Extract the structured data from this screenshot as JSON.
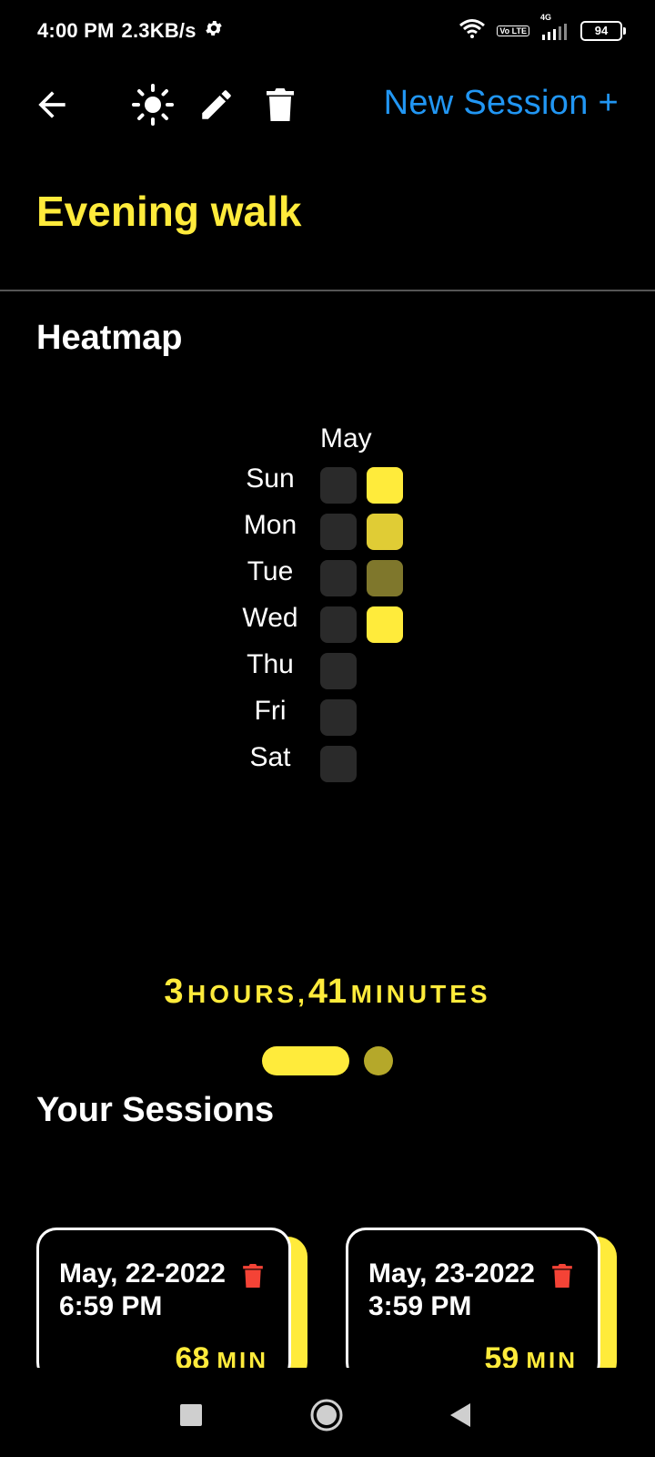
{
  "status_bar": {
    "time": "4:00 PM",
    "speed": "2.3KB/s",
    "volte": "Vo LTE",
    "network": "4G",
    "battery": "94"
  },
  "toolbar": {
    "new_session_label": "New Session +"
  },
  "activity": {
    "title": "Evening walk"
  },
  "heatmap": {
    "section_title": "Heatmap",
    "month": "May",
    "days": [
      "Sun",
      "Mon",
      "Tue",
      "Wed",
      "Thu",
      "Fri",
      "Sat"
    ],
    "cell_colors": {
      "empty": "#2a2a2a",
      "col2": [
        "#ffeb3b",
        "#e0cc35",
        "#7f772c",
        "#ffeb3b"
      ]
    }
  },
  "total": {
    "hours": "3",
    "hours_unit": "HOURS,",
    "minutes": "41",
    "minutes_unit": "MINUTES"
  },
  "sessions": {
    "section_title": "Your Sessions",
    "items": [
      {
        "date": "May, 22-2022",
        "time": "6:59 PM",
        "minutes": "68",
        "unit": "MIN"
      },
      {
        "date": "May, 23-2022",
        "time": "3:59 PM",
        "minutes": "59",
        "unit": "MIN"
      }
    ]
  },
  "colors": {
    "accent": "#ffeb3b",
    "link": "#2196f3",
    "delete": "#f44336"
  }
}
